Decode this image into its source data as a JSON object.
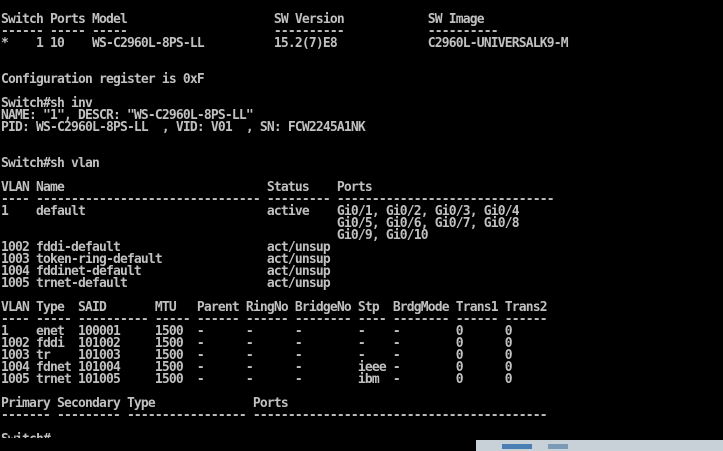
{
  "terminal": {
    "lines": [
      "Switch Ports Model                     SW Version            SW Image",
      "------ ----- -----                     ----------            ----------",
      "*    1 10    WS-C2960L-8PS-LL          15.2(7)E8             C2960L-UNIVERSALK9-M",
      "",
      "",
      "Configuration register is 0xF",
      "",
      "Switch#sh inv",
      "NAME: \"1\", DESCR: \"WS-C2960L-8PS-LL\"",
      "PID: WS-C2960L-8PS-LL  , VID: V01  , SN: FCW2245A1NK",
      "",
      "",
      "Switch#sh vlan",
      "",
      "VLAN Name                             Status    Ports",
      "---- -------------------------------- --------- -------------------------------",
      "1    default                          active    Gi0/1, Gi0/2, Gi0/3, Gi0/4",
      "                                                Gi0/5, Gi0/6, Gi0/7, Gi0/8",
      "                                                Gi0/9, Gi0/10",
      "1002 fddi-default                     act/unsup",
      "1003 token-ring-default               act/unsup",
      "1004 fddinet-default                  act/unsup",
      "1005 trnet-default                    act/unsup",
      "",
      "VLAN Type  SAID       MTU   Parent RingNo BridgeNo Stp  BrdgMode Trans1 Trans2",
      "---- ----- ---------- ----- ------ ------ -------- ---- -------- ------ ------",
      "1    enet  100001     1500  -      -      -        -    -        0      0",
      "1002 fddi  101002     1500  -      -      -        -    -        0      0",
      "1003 tr    101003     1500  -      -      -        -    -        0      0",
      "1004 fdnet 101004     1500  -      -      -        ieee -        0      0",
      "1005 trnet 101005     1500  -      -      -        ibm  -        0      0",
      "",
      "Primary Secondary Type              Ports",
      "------- --------- ----------------- ------------------------------------------",
      "",
      "Switch#"
    ]
  }
}
